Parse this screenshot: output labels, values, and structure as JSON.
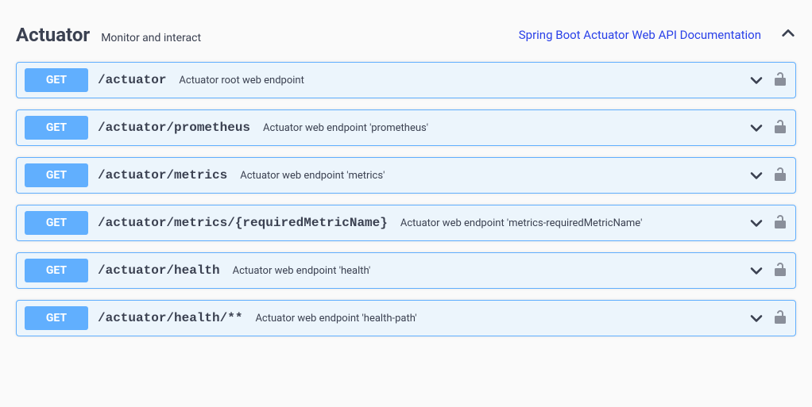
{
  "section": {
    "title": "Actuator",
    "subtitle": "Monitor and interact",
    "docs_link_label": "Spring Boot Actuator Web API Documentation"
  },
  "methods": {
    "get": "GET"
  },
  "endpoints": [
    {
      "method": "GET",
      "path": "/actuator",
      "description": "Actuator root web endpoint"
    },
    {
      "method": "GET",
      "path": "/actuator/prometheus",
      "description": "Actuator web endpoint 'prometheus'"
    },
    {
      "method": "GET",
      "path": "/actuator/metrics",
      "description": "Actuator web endpoint 'metrics'"
    },
    {
      "method": "GET",
      "path": "/actuator/metrics/{requiredMetricName}",
      "description": "Actuator web endpoint 'metrics-requiredMetricName'"
    },
    {
      "method": "GET",
      "path": "/actuator/health",
      "description": "Actuator web endpoint 'health'"
    },
    {
      "method": "GET",
      "path": "/actuator/health/**",
      "description": "Actuator web endpoint 'health-path'"
    }
  ]
}
